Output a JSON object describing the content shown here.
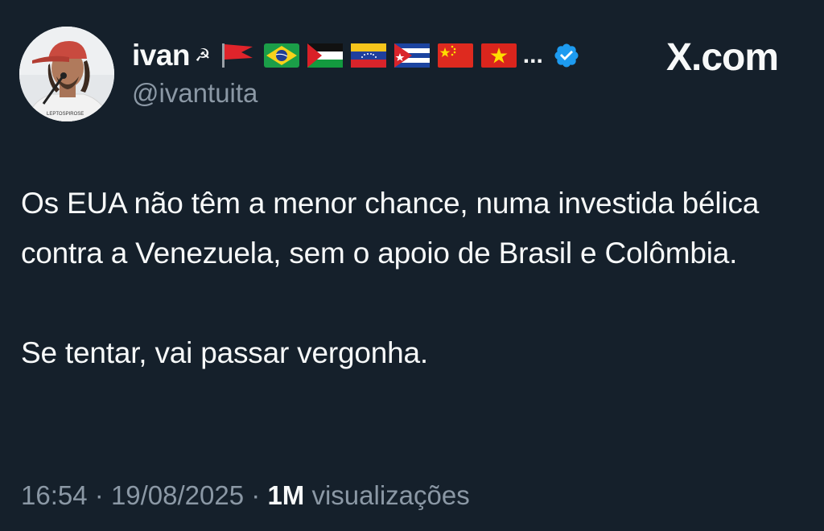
{
  "author": {
    "display_name": "ivan",
    "handle": "@ivantuita",
    "avatar_shirt_text": "LEPTOSPIROSE",
    "badges": [
      "hammer-sickle-icon",
      "red-flag-icon",
      "flag-brazil-icon",
      "flag-palestine-icon",
      "flag-venezuela-icon",
      "flag-cuba-icon",
      "flag-china-icon",
      "flag-vietnam-icon"
    ],
    "ellipsis": "...",
    "verified": true
  },
  "brand": {
    "label": "X.com"
  },
  "tweet": {
    "paragraph_1": "Os EUA não têm a menor chance, numa investida bélica contra a Venezuela, sem o apoio de Brasil e Colômbia.",
    "paragraph_2": "Se tentar, vai passar vergonha."
  },
  "meta": {
    "time": "16:54",
    "separator": "·",
    "date": "19/08/2025",
    "views_count": "1M",
    "views_label": "visualizações"
  },
  "colors": {
    "background": "#15202b",
    "text": "#f7f9f9",
    "secondary": "#8b98a5",
    "verified": "#1d9bf0"
  }
}
